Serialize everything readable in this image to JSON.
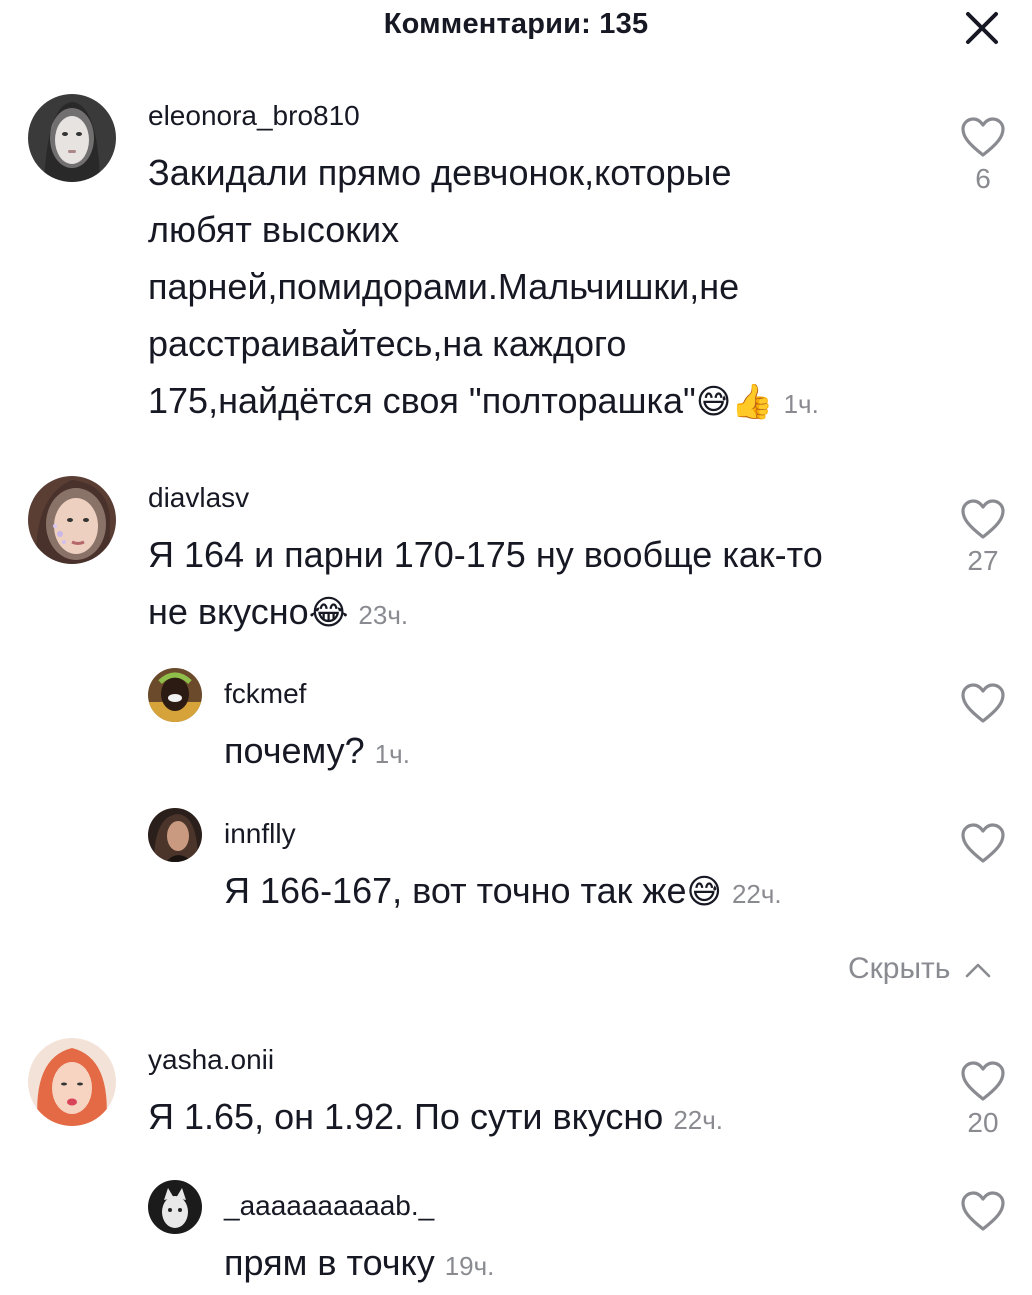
{
  "header": {
    "title": "Комментарии: 135"
  },
  "comments": [
    {
      "username": "eleonora_bro810",
      "text": "Закидали прямо девчонок,которые любят высоких парней,помидорами.Мальчишки,не расстраивайтесь,на каждого 175,найдётся своя \"полторашка\"",
      "lines": [
        "Закидали прямо девчонок,которые",
        "любят высоких",
        "парней,помидорами.Мальчишки,не",
        "расстраивайтесь,на каждого",
        "175,найдётся своя \"полторашка\""
      ],
      "emoji": "😅👍",
      "time": "1ч.",
      "likes": "6"
    },
    {
      "username": "diavlasv",
      "lines": [
        "Я 164 и парни 170-175 ну вообще как-то",
        "не вкусно"
      ],
      "emoji": "😂",
      "time": "23ч.",
      "likes": "27",
      "replies": [
        {
          "username": "fckmef",
          "text": "почему?",
          "emoji": "",
          "time": "1ч."
        },
        {
          "username": "innflly",
          "text": "Я 166-167, вот точно так же",
          "emoji": "😅",
          "time": "22ч."
        }
      ],
      "hide_label": "Скрыть"
    },
    {
      "username": "yasha.onii",
      "lines": [
        "Я 1.65, он 1.92. По сути вкусно"
      ],
      "emoji": "",
      "time": "22ч.",
      "likes": "20",
      "replies": [
        {
          "username": "_aaaaaaaaaab._",
          "text": "прям в точку",
          "emoji": "",
          "time": "19ч."
        }
      ]
    }
  ],
  "icons": {
    "close": "close-icon",
    "like": "heart-outline-icon",
    "chevron": "chevron-up-icon"
  },
  "colors": {
    "text": "#161823",
    "muted": "#8a8b91"
  }
}
